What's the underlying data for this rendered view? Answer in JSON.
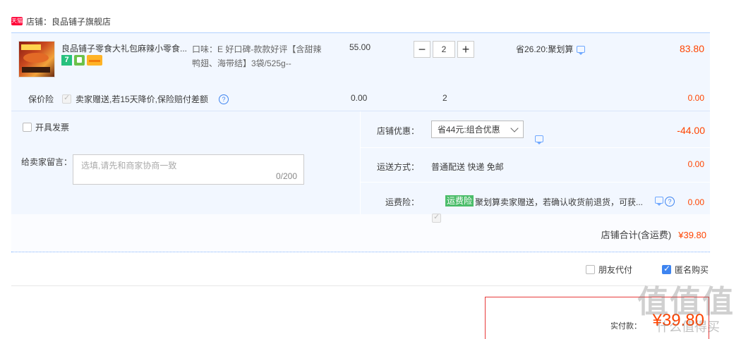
{
  "shop": {
    "badge": "天猫",
    "label": "店铺：良品铺子旗舰店"
  },
  "item": {
    "title": "良品铺子零食大礼包麻辣小零食...",
    "icon7": "7",
    "sku": "口味：E 好口碑-款款好评【含甜辣鸭翅、海带结】3袋/525g--",
    "price": "55.00",
    "qty_minus": "−",
    "qty_value": "2",
    "qty_plus": "+",
    "saving": "省26.20:聚划算",
    "subtotal": "83.80"
  },
  "insurance": {
    "label": "保价险",
    "text": "卖家赠送,若15天降价,保险赔付差额",
    "help": "?",
    "price": "0.00",
    "qty": "2",
    "total": "0.00"
  },
  "invoice": {
    "label": "开具发票"
  },
  "message": {
    "label": "给卖家留言：",
    "placeholder": "选填,请先和商家协商一致",
    "count": "0/200"
  },
  "discount": {
    "label": "店铺优惠：",
    "selected": "省44元:组合优惠",
    "value": "-44.00"
  },
  "shipping": {
    "label": "运送方式：",
    "value": "普通配送 快递 免邮",
    "price": "0.00"
  },
  "freight_insurance": {
    "label": "运费险：",
    "badge": "运费险",
    "text": "聚划算卖家赠送，若确认收货前退货，可获...",
    "price": "0.00"
  },
  "shop_total": {
    "label": "店铺合计(含运费)",
    "value": "¥39.80"
  },
  "options": {
    "friend_pay": "朋友代付",
    "anonymous": "匿名购买"
  },
  "payment": {
    "label": "实付款：",
    "value": "¥39.80"
  },
  "watermark": {
    "text": "值值值",
    "sub": "什么值得买"
  },
  "colors": {
    "accent_red": "#ff4400",
    "blue": "#3d84f0",
    "badge_green": "#4bbd6a"
  }
}
